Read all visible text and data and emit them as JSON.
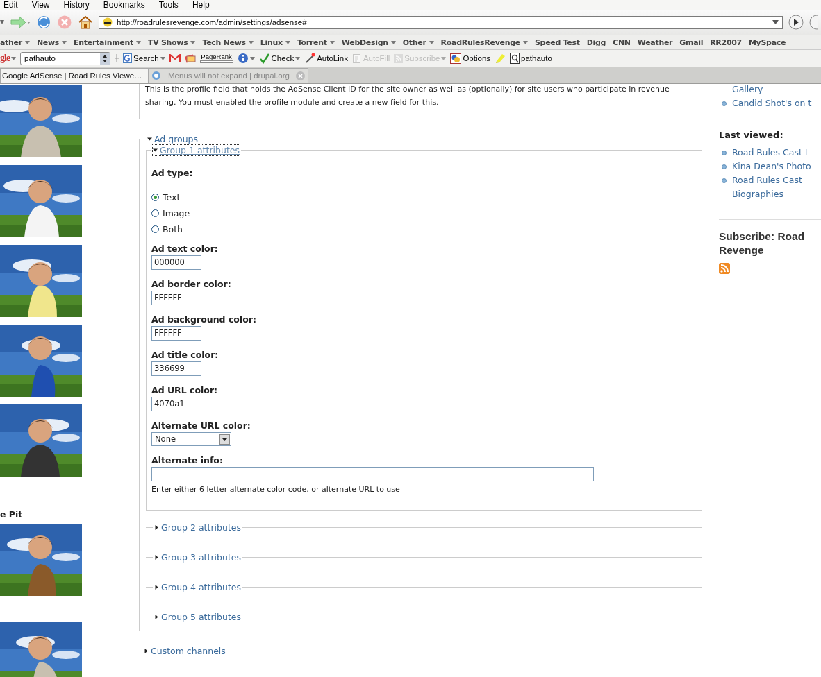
{
  "menu_bar": [
    "Edit",
    "View",
    "History",
    "Bookmarks",
    "Tools",
    "Help"
  ],
  "navigation": {
    "url": "http://roadrulesrevenge.com/admin/settings/adsense#"
  },
  "bookmarks": [
    {
      "label": "ather",
      "dropdown": true
    },
    {
      "label": "News",
      "dropdown": true
    },
    {
      "label": "Entertainment",
      "dropdown": true
    },
    {
      "label": "TV Shows",
      "dropdown": true
    },
    {
      "label": "Tech News",
      "dropdown": true
    },
    {
      "label": "Linux",
      "dropdown": true
    },
    {
      "label": "Torrent",
      "dropdown": true
    },
    {
      "label": "WebDesign",
      "dropdown": true
    },
    {
      "label": "Other",
      "dropdown": true
    },
    {
      "label": "RoadRulesRevenge",
      "dropdown": true
    },
    {
      "label": "Speed Test",
      "dropdown": false
    },
    {
      "label": "Digg",
      "dropdown": false
    },
    {
      "label": "CNN",
      "dropdown": false
    },
    {
      "label": "Weather",
      "dropdown": false
    },
    {
      "label": "Gmail",
      "dropdown": false
    },
    {
      "label": "RR2007",
      "dropdown": false
    },
    {
      "label": "MySpace",
      "dropdown": false
    }
  ],
  "google_toolbar": {
    "logo": "gle",
    "search_value": "pathauto",
    "buttons": [
      {
        "kind": "search",
        "label": "Search",
        "disabled": false
      },
      {
        "kind": "mail"
      },
      {
        "kind": "cards"
      },
      {
        "kind": "pagerank",
        "label": "PageRank",
        "disabled": false
      },
      {
        "kind": "info"
      },
      {
        "kind": "check",
        "label": "Check",
        "disabled": false
      },
      {
        "kind": "autolink",
        "label": "AutoLink",
        "disabled": false
      },
      {
        "kind": "autofill",
        "label": "AutoFill",
        "disabled": true
      },
      {
        "kind": "subscribe",
        "label": "Subscribe",
        "disabled": true
      },
      {
        "kind": "options",
        "label": "Options",
        "disabled": false
      },
      {
        "kind": "highlight"
      },
      {
        "kind": "pathauto",
        "label": "pathauto",
        "disabled": false
      }
    ]
  },
  "tabs": [
    {
      "label": "Google AdSense | Road Rules Viewe…",
      "selected": true
    },
    {
      "label": "Menus will not expand | drupal.org",
      "selected": false
    }
  ],
  "left_column": [
    {
      "kind": "picture"
    },
    {
      "kind": "picture"
    },
    {
      "kind": "picture"
    },
    {
      "kind": "picture"
    },
    {
      "kind": "picture"
    },
    {
      "kind": "heading",
      "text": "e Pit"
    },
    {
      "kind": "picture"
    },
    {
      "kind": "picture"
    }
  ],
  "main": {
    "description": "This is the profile field that holds the AdSense Client ID for the site owner as well as (optionally) for site users who participate in revenue sharing. You must enabled the profile module and create a new field for this.",
    "ad_groups": {
      "legend": "Ad groups",
      "expanded": true,
      "groups": [
        {
          "legend": "Group 1 attributes",
          "expanded": true,
          "fields": [
            {
              "kind": "radios",
              "label": "Ad type:",
              "options": [
                {
                  "label": "Text",
                  "selected": true
                },
                {
                  "label": "Image",
                  "selected": false
                },
                {
                  "label": "Both",
                  "selected": false
                }
              ]
            },
            {
              "kind": "text",
              "label": "Ad text color:",
              "value": "000000"
            },
            {
              "kind": "text",
              "label": "Ad border color:",
              "value": "FFFFFF"
            },
            {
              "kind": "text",
              "label": "Ad background color:",
              "value": "FFFFFF"
            },
            {
              "kind": "text",
              "label": "Ad title color:",
              "value": "336699"
            },
            {
              "kind": "text",
              "label": "Ad URL color:",
              "value": "4070a1"
            },
            {
              "kind": "select",
              "label": "Alternate URL color:",
              "value": "None"
            },
            {
              "kind": "wide",
              "label": "Alternate info:",
              "description": "Enter either 6 letter alternate color code, or alternate URL to use"
            }
          ]
        },
        {
          "legend": "Group 2 attributes",
          "expanded": false
        },
        {
          "legend": "Group 3 attributes",
          "expanded": false
        },
        {
          "legend": "Group 4 attributes",
          "expanded": false
        },
        {
          "legend": "Group 5 attributes",
          "expanded": false
        }
      ]
    },
    "custom_channels": {
      "legend": "Custom channels",
      "expanded": false
    }
  },
  "sidebar": {
    "top_links": [
      "Gallery",
      "Candid Shot's on t"
    ],
    "last_viewed": {
      "heading": "Last viewed:",
      "links": [
        "Road Rules Cast I",
        "Kina Dean's Photo",
        "Road Rules Cast Biographies"
      ]
    },
    "subscribe": {
      "heading": "Subscribe: Road Revenge"
    }
  }
}
